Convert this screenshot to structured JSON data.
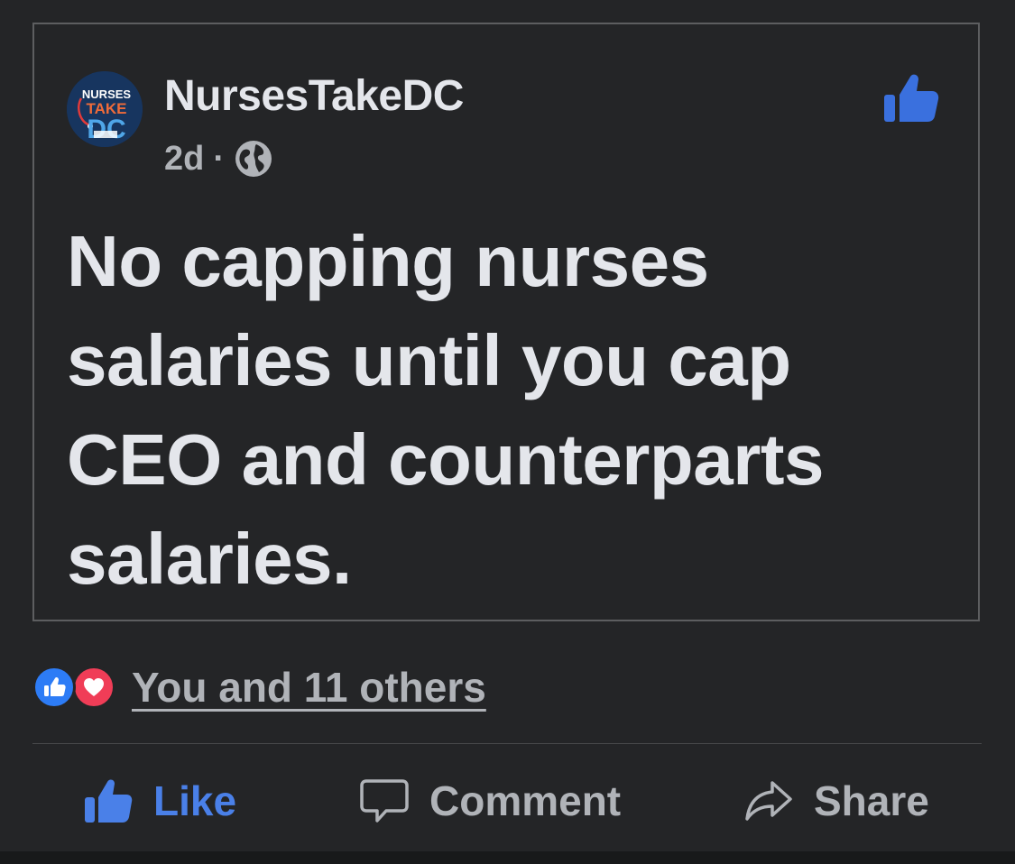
{
  "post": {
    "author": "NursesTakeDC",
    "timestamp": "2d",
    "separator": "·",
    "audience_icon": "globe-icon",
    "avatar_logo_lines": [
      "NURSES",
      "TAKE",
      "DC"
    ],
    "text": "No capping nurses salaries until you cap CEO and counterparts salaries."
  },
  "reactions": {
    "icons": [
      "like-reaction-icon",
      "love-reaction-icon"
    ],
    "summary": "You and 11 others"
  },
  "actions": {
    "like_label": "Like",
    "comment_label": "Comment",
    "share_label": "Share"
  },
  "colors": {
    "background": "#242527",
    "text_primary": "#e4e6eb",
    "text_secondary": "#b0b3b8",
    "accent_blue": "#4a80e8",
    "like_reaction": "#2d7cf6",
    "love_reaction": "#f03d57"
  }
}
